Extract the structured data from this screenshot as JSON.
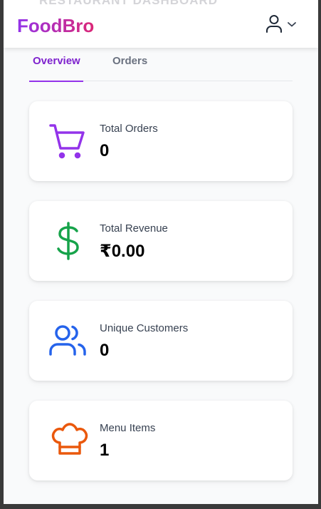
{
  "header": {
    "brand": "FoodBro",
    "background_text": "RESTAURANT DASHBOARD",
    "user_icon": "user-icon",
    "dropdown_icon": "chevron-down-icon"
  },
  "tabs": [
    {
      "label": "Overview",
      "active": true
    },
    {
      "label": "Orders",
      "active": false
    }
  ],
  "stats": [
    {
      "label": "Total Orders",
      "value": "0",
      "icon": "shopping-cart-icon",
      "color": "#9333ea"
    },
    {
      "label": "Total Revenue",
      "value": "₹0.00",
      "icon": "dollar-icon",
      "color": "#16a34a"
    },
    {
      "label": "Unique Customers",
      "value": "0",
      "icon": "users-icon",
      "color": "#2563eb"
    },
    {
      "label": "Menu Items",
      "value": "1",
      "icon": "chef-hat-icon",
      "color": "#ea580c"
    }
  ],
  "colors": {
    "brand_gradient_start": "#9333ea",
    "brand_gradient_end": "#db2777",
    "active_tab": "#7e22ce",
    "page_background": "#f9fafb"
  }
}
